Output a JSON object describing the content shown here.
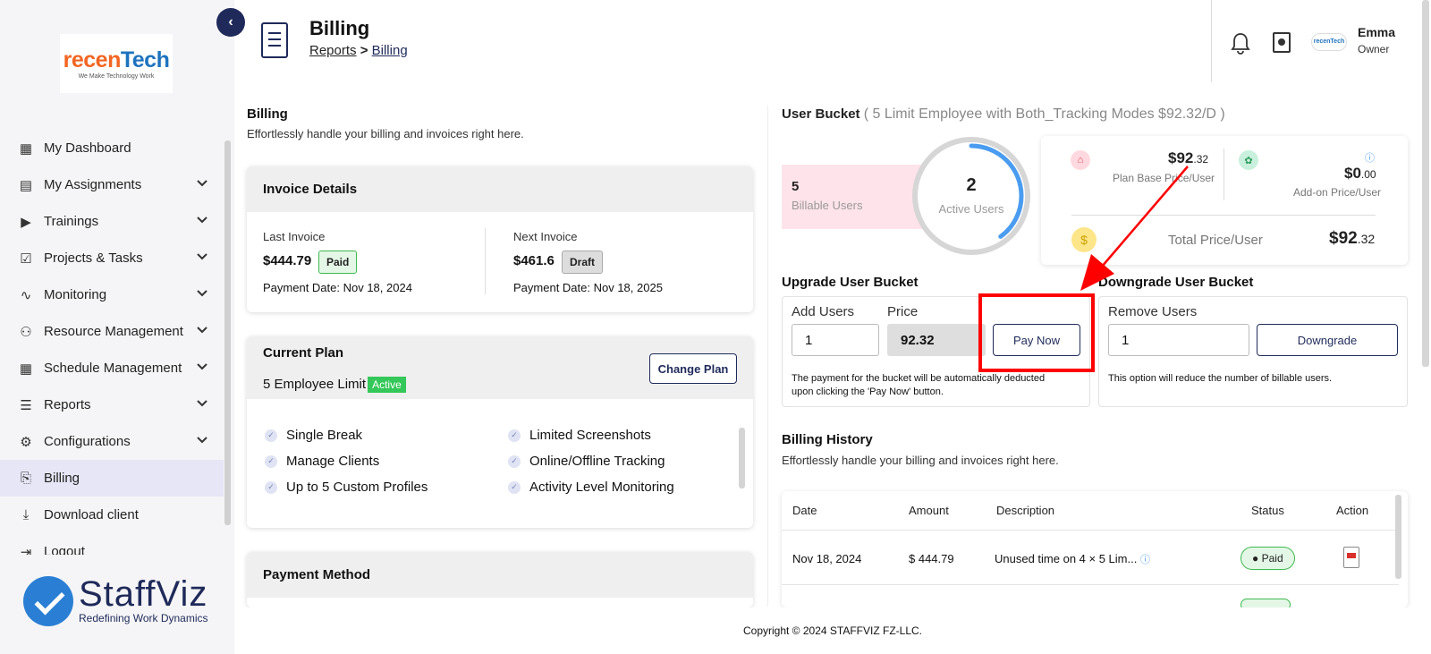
{
  "sidebar": {
    "logo_text_a": "recen",
    "logo_text_b": "Tech",
    "logo_tagline": "We Make Technology Work",
    "items": [
      {
        "label": "My Dashboard",
        "icon": "dashboard-icon",
        "chevron": false
      },
      {
        "label": "My Assignments",
        "icon": "assignments-icon",
        "chevron": true
      },
      {
        "label": "Trainings",
        "icon": "play-icon",
        "chevron": true
      },
      {
        "label": "Projects & Tasks",
        "icon": "clipboard-icon",
        "chevron": true
      },
      {
        "label": "Monitoring",
        "icon": "monitoring-icon",
        "chevron": true
      },
      {
        "label": "Resource Management",
        "icon": "people-icon",
        "chevron": true
      },
      {
        "label": "Schedule Management",
        "icon": "calendar-icon",
        "chevron": true
      },
      {
        "label": "Reports",
        "icon": "report-icon",
        "chevron": true
      },
      {
        "label": "Configurations",
        "icon": "gear-icon",
        "chevron": true
      },
      {
        "label": "Billing",
        "icon": "billing-icon",
        "chevron": false,
        "active": true
      },
      {
        "label": "Download client",
        "icon": "download-icon",
        "chevron": false
      },
      {
        "label": "Logout",
        "icon": "logout-icon",
        "chevron": false
      }
    ],
    "brand_name": "StaffViz",
    "brand_tagline": "Redefining Work Dynamics"
  },
  "header": {
    "title": "Billing",
    "breadcrumb_1": "Reports",
    "breadcrumb_sep": ">",
    "breadcrumb_2": "Billing",
    "mini_logo": "recenTech",
    "user_name": "Emma",
    "user_role": "Owner"
  },
  "billing": {
    "title": "Billing",
    "subtitle": "Effortlessly handle your billing and invoices right here."
  },
  "invoice": {
    "title": "Invoice Details",
    "last_label": "Last Invoice",
    "last_amount": "$444.79",
    "last_status": "Paid",
    "last_date": "Payment Date: Nov 18, 2024",
    "next_label": "Next Invoice",
    "next_amount": "$461.6",
    "next_status": "Draft",
    "next_date": "Payment Date: Nov 18, 2025"
  },
  "plan": {
    "title": "Current Plan",
    "name": "5 Employee Limit",
    "status": "Active",
    "change_button": "Change Plan",
    "features": [
      "Single Break",
      "Limited Screenshots",
      "Manage Clients",
      "Online/Offline Tracking",
      "Up to 5 Custom Profiles",
      "Activity Level Monitoring"
    ]
  },
  "payment": {
    "title": "Payment Method"
  },
  "bucket": {
    "title": "User Bucket",
    "detail": "( 5 Limit Employee with Both_Tracking Modes $92.32/D )",
    "billable_count": "5",
    "billable_label": "Billable Users",
    "active_count": "2",
    "active_label": "Active Users",
    "active_ratio": 0.4,
    "plan_base_price_main": "$92",
    "plan_base_price_cents": ".32",
    "plan_base_label": "Plan Base Price/User",
    "addon_price_main": "$0",
    "addon_price_cents": ".00",
    "addon_label": "Add-on Price/User",
    "total_label": "Total Price/User",
    "total_main": "$92",
    "total_cents": ".32"
  },
  "upgrade": {
    "title": "Upgrade User Bucket",
    "add_users_label": "Add Users",
    "add_users_value": "1",
    "price_label": "Price",
    "price_value": "92.32",
    "pay_button": "Pay Now",
    "note": "The payment for the bucket will be automatically deducted upon clicking the 'Pay Now' button."
  },
  "downgrade": {
    "title": "Downgrade User Bucket",
    "remove_label": "Remove Users",
    "remove_value": "1",
    "button": "Downgrade",
    "note": "This option will reduce the number of billable users."
  },
  "history": {
    "title": "Billing History",
    "subtitle": "Effortlessly handle your billing and invoices right here.",
    "columns": [
      "Date",
      "Amount",
      "Description",
      "Status",
      "Action"
    ],
    "rows": [
      {
        "date": "Nov 18, 2024",
        "amount": "$ 444.79",
        "description": "Unused time on 4 × 5 Lim...",
        "status": "Paid"
      }
    ]
  },
  "footer": {
    "copyright": "Copyright © 2024 STAFFVIZ FZ-LLC."
  },
  "colors": {
    "navy": "#1f2a5a",
    "accent_blue": "#4a9cf0",
    "paid_green": "#3fb950",
    "active_green": "#34c759",
    "annotation_red": "#ff0000"
  }
}
